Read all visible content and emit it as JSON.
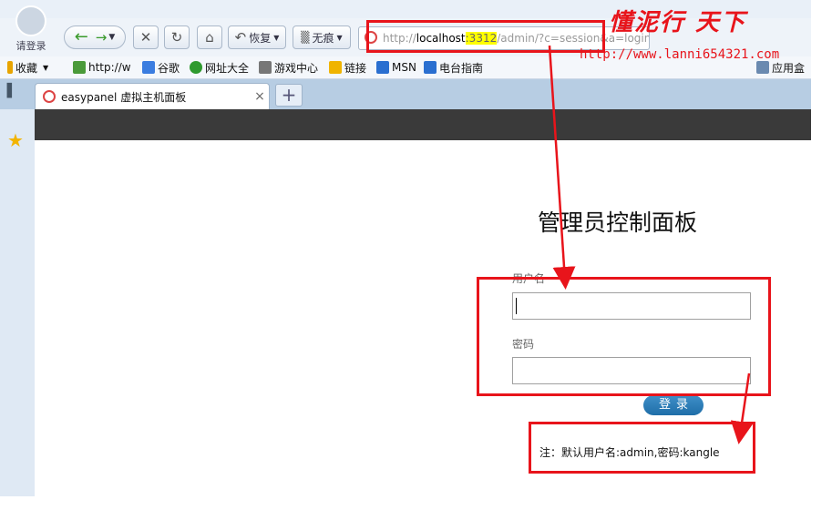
{
  "browser": {
    "login_label": "请登录",
    "restore_label": "恢复",
    "incognito_label": "无痕",
    "address": {
      "prefix": "http://",
      "host": "localhost",
      "port": ":3312",
      "path": "/admin/?c=session&a=loginForm"
    },
    "bookmarks": [
      {
        "label": "收藏",
        "color": "#e8a400"
      },
      {
        "label": "http://w",
        "color": "#4a9a3a"
      },
      {
        "label": "谷歌",
        "color": "#3b7de0"
      },
      {
        "label": "网址大全",
        "color": "#2f9a2f"
      },
      {
        "label": "游戏中心",
        "color": "#777777"
      },
      {
        "label": "链接",
        "color": "#f0b400"
      },
      {
        "label": "MSN",
        "color": "#2a6fd0"
      },
      {
        "label": "电台指南",
        "color": "#2a6fd0"
      },
      {
        "label": "应用盒",
        "color": "#6a8ab0"
      }
    ],
    "tab_label": "easypanel 虚拟主机面板",
    "tab_close": "×",
    "new_tab": "+"
  },
  "page": {
    "title": "管理员控制面板",
    "username_label": "用户名",
    "password_label": "密码",
    "login_button": "登录",
    "note": "注：默认用户名:admin,密码:kangle"
  },
  "watermark": {
    "title": "懂泥行 天下",
    "url": "http://www.lanni654321.com"
  },
  "colors": {
    "annotation": "#e8141b",
    "header_bar": "#3a3a3a",
    "button": "#2a7bb8",
    "highlight": "#ffff00"
  }
}
